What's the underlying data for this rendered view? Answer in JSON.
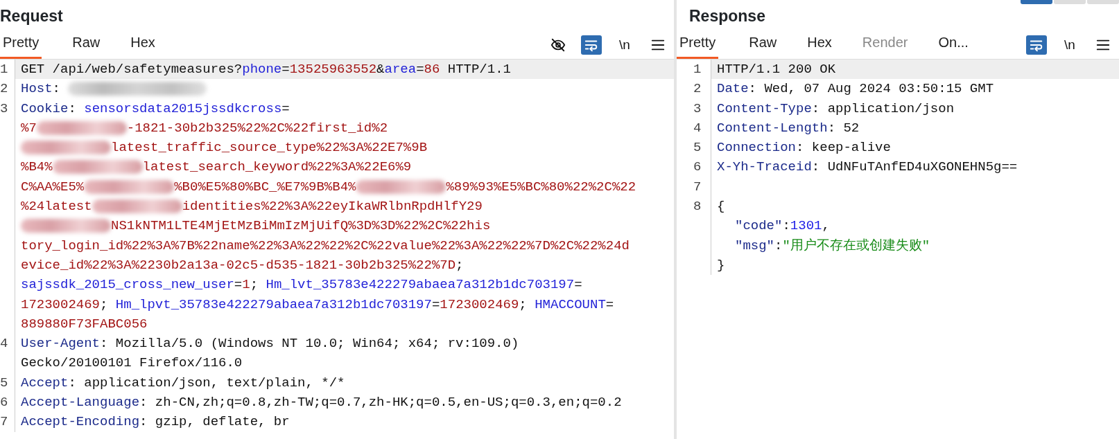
{
  "window": {
    "top_buttons": [
      {
        "selected": true
      },
      {
        "selected": false
      },
      {
        "selected": false
      }
    ]
  },
  "request": {
    "title": "Request",
    "tabs": [
      {
        "label": "Pretty",
        "selected": true,
        "disabled": false
      },
      {
        "label": "Raw",
        "selected": false,
        "disabled": false
      },
      {
        "label": "Hex",
        "selected": false,
        "disabled": false
      }
    ],
    "tools": [
      {
        "kind": "eye_off",
        "on": false
      },
      {
        "kind": "wrap",
        "on": true
      },
      {
        "kind": "newline",
        "on": false,
        "label": "\\n"
      },
      {
        "kind": "menu",
        "on": false
      }
    ],
    "lines": [
      {
        "number": "1",
        "highlighted": true,
        "segments": [
          {
            "kind": "plain",
            "text": "GET /api/web/safetymeasures?"
          },
          {
            "kind": "key",
            "text": "phone"
          },
          {
            "kind": "plain",
            "text": "="
          },
          {
            "kind": "value",
            "text": "13525963552"
          },
          {
            "kind": "plain",
            "text": "&"
          },
          {
            "kind": "key",
            "text": "area"
          },
          {
            "kind": "plain",
            "text": "="
          },
          {
            "kind": "value",
            "text": "86"
          },
          {
            "kind": "plain",
            "text": " HTTP/1.1"
          }
        ]
      },
      {
        "number": "2",
        "highlighted": false,
        "segments": [
          {
            "kind": "header",
            "text": "Host"
          },
          {
            "kind": "plain",
            "text": ": "
          },
          {
            "kind": "blur_grey"
          }
        ]
      },
      {
        "number": "3",
        "highlighted": false,
        "segments": [
          {
            "kind": "header",
            "text": "Cookie"
          },
          {
            "kind": "plain",
            "text": ": "
          },
          {
            "kind": "key",
            "text": "sensorsdata2015jssdkcross"
          },
          {
            "kind": "plain",
            "text": "="
          }
        ]
      },
      {
        "highlighted": false,
        "segments": [
          {
            "kind": "value",
            "text": "%7"
          },
          {
            "kind": "blur_red"
          },
          {
            "kind": "value",
            "text": "-1821-30b2b325%22%2C%22first_id%2"
          }
        ]
      },
      {
        "highlighted": false,
        "segments": [
          {
            "kind": "blur_red"
          },
          {
            "kind": "value",
            "text": "latest_traffic_source_type%22%3A%22E7%9B"
          }
        ]
      },
      {
        "highlighted": false,
        "segments": [
          {
            "kind": "value",
            "text": "%B4%"
          },
          {
            "kind": "blur_red"
          },
          {
            "kind": "value",
            "text": "latest_search_keyword%22%3A%22E6%9"
          }
        ]
      },
      {
        "highlighted": false,
        "segments": [
          {
            "kind": "value",
            "text": "C%AA%E5%"
          },
          {
            "kind": "blur_red"
          },
          {
            "kind": "value",
            "text": "%B0%E5%80%BC_%E7%9B%B4%"
          },
          {
            "kind": "blur_red"
          },
          {
            "kind": "value",
            "text": "%89%93%E5%BC%80%22%2C%22"
          }
        ]
      },
      {
        "highlighted": false,
        "segments": [
          {
            "kind": "value",
            "text": "%24latest"
          },
          {
            "kind": "blur_red"
          },
          {
            "kind": "value",
            "text": "identities%22%3A%22eyIkaWRlbnRpdHlfY29"
          }
        ]
      },
      {
        "highlighted": false,
        "segments": [
          {
            "kind": "blur_red"
          },
          {
            "kind": "value",
            "text": "NS1kNTM1LTE4MjEtMzBiMmIzMjUifQ%3D%3D%22%2C%22his"
          }
        ]
      },
      {
        "highlighted": false,
        "segments": [
          {
            "kind": "value",
            "text": "tory_login_id%22%3A%7B%22name%22%3A%22%22%2C%22value%22%3A%22%22%7D%2C%22%24d"
          }
        ]
      },
      {
        "highlighted": false,
        "segments": [
          {
            "kind": "value",
            "text": "evice_id%22%3A%2230b2a13a-02c5-d535-1821-30b2b325%22%7D"
          },
          {
            "kind": "plain",
            "text": ";"
          }
        ]
      },
      {
        "highlighted": false,
        "segments": [
          {
            "kind": "key",
            "text": "sajssdk_2015_cross_new_user"
          },
          {
            "kind": "plain",
            "text": "="
          },
          {
            "kind": "value",
            "text": "1"
          },
          {
            "kind": "plain",
            "text": "; "
          },
          {
            "kind": "key",
            "text": "Hm_lvt_35783e422279abaea7a312b1dc703197"
          },
          {
            "kind": "plain",
            "text": "="
          }
        ]
      },
      {
        "highlighted": false,
        "segments": [
          {
            "kind": "value",
            "text": "1723002469"
          },
          {
            "kind": "plain",
            "text": "; "
          },
          {
            "kind": "key",
            "text": "Hm_lpvt_35783e422279abaea7a312b1dc703197"
          },
          {
            "kind": "plain",
            "text": "="
          },
          {
            "kind": "value",
            "text": "1723002469"
          },
          {
            "kind": "plain",
            "text": "; "
          },
          {
            "kind": "key",
            "text": "HMACCOUNT"
          },
          {
            "kind": "plain",
            "text": "="
          }
        ]
      },
      {
        "highlighted": false,
        "segments": [
          {
            "kind": "value",
            "text": "889880F73FABC056"
          }
        ]
      },
      {
        "number": "4",
        "highlighted": false,
        "segments": [
          {
            "kind": "header",
            "text": "User-Agent"
          },
          {
            "kind": "plain",
            "text": ": Mozilla/5.0 (Windows NT 10.0; Win64; x64; rv:109.0)"
          }
        ]
      },
      {
        "highlighted": false,
        "segments": [
          {
            "kind": "plain",
            "text": "Gecko/20100101 Firefox/116.0"
          }
        ]
      },
      {
        "number": "5",
        "highlighted": false,
        "segments": [
          {
            "kind": "header",
            "text": "Accept"
          },
          {
            "kind": "plain",
            "text": ": application/json, text/plain, */*"
          }
        ]
      },
      {
        "number": "6",
        "highlighted": false,
        "segments": [
          {
            "kind": "header",
            "text": "Accept-Language"
          },
          {
            "kind": "plain",
            "text": ": zh-CN,zh;q=0.8,zh-TW;q=0.7,zh-HK;q=0.5,en-US;q=0.3,en;q=0.2"
          }
        ]
      },
      {
        "number": "7",
        "highlighted": false,
        "segments": [
          {
            "kind": "header",
            "text": "Accept-Encoding"
          },
          {
            "kind": "plain",
            "text": ": gzip, deflate, br"
          }
        ]
      }
    ]
  },
  "response": {
    "title": "Response",
    "tabs": [
      {
        "label": "Pretty",
        "selected": true,
        "disabled": false
      },
      {
        "label": "Raw",
        "selected": false,
        "disabled": false
      },
      {
        "label": "Hex",
        "selected": false,
        "disabled": false
      },
      {
        "label": "Render",
        "selected": false,
        "disabled": true
      },
      {
        "label": "On...",
        "selected": false,
        "disabled": false
      }
    ],
    "tools": [
      {
        "kind": "wrap",
        "on": true
      },
      {
        "kind": "newline",
        "on": false,
        "label": "\\n"
      },
      {
        "kind": "menu",
        "on": false
      }
    ],
    "lines": [
      {
        "number": "1",
        "highlighted": true,
        "segments": [
          {
            "kind": "plain",
            "text": "HTTP/1.1 200 OK"
          }
        ]
      },
      {
        "number": "2",
        "highlighted": false,
        "segments": [
          {
            "kind": "header",
            "text": "Date"
          },
          {
            "kind": "plain",
            "text": ": Wed, 07 Aug 2024 03:50:15 GMT"
          }
        ]
      },
      {
        "number": "3",
        "highlighted": false,
        "segments": [
          {
            "kind": "header",
            "text": "Content-Type"
          },
          {
            "kind": "plain",
            "text": ": application/json"
          }
        ]
      },
      {
        "number": "4",
        "highlighted": false,
        "segments": [
          {
            "kind": "header",
            "text": "Content-Length"
          },
          {
            "kind": "plain",
            "text": ": 52"
          }
        ]
      },
      {
        "number": "5",
        "highlighted": false,
        "segments": [
          {
            "kind": "header",
            "text": "Connection"
          },
          {
            "kind": "plain",
            "text": ": keep-alive"
          }
        ]
      },
      {
        "number": "6",
        "highlighted": false,
        "segments": [
          {
            "kind": "header",
            "text": "X-Yh-Traceid"
          },
          {
            "kind": "plain",
            "text": ": UdNFuTAnfED4uXGONEHN5g=="
          }
        ]
      },
      {
        "number": "7",
        "highlighted": false
      },
      {
        "number": "8",
        "highlighted": false,
        "segments": [
          {
            "kind": "plain",
            "text": "{"
          }
        ],
        "children": [
          {
            "highlighted": false,
            "segments": [
              {
                "kind": "header",
                "text": "\"code\""
              },
              {
                "kind": "plain",
                "text": ":"
              },
              {
                "kind": "number",
                "text": "1301"
              },
              {
                "kind": "plain",
                "text": ","
              }
            ]
          },
          {
            "highlighted": false,
            "segments": [
              {
                "kind": "header",
                "text": "\"msg\""
              },
              {
                "kind": "plain",
                "text": ":"
              },
              {
                "kind": "string",
                "text": "\"用户不存在或创建失败\""
              }
            ]
          }
        ]
      },
      {
        "highlighted": false,
        "segments": [
          {
            "kind": "plain",
            "text": "}"
          }
        ]
      }
    ]
  }
}
